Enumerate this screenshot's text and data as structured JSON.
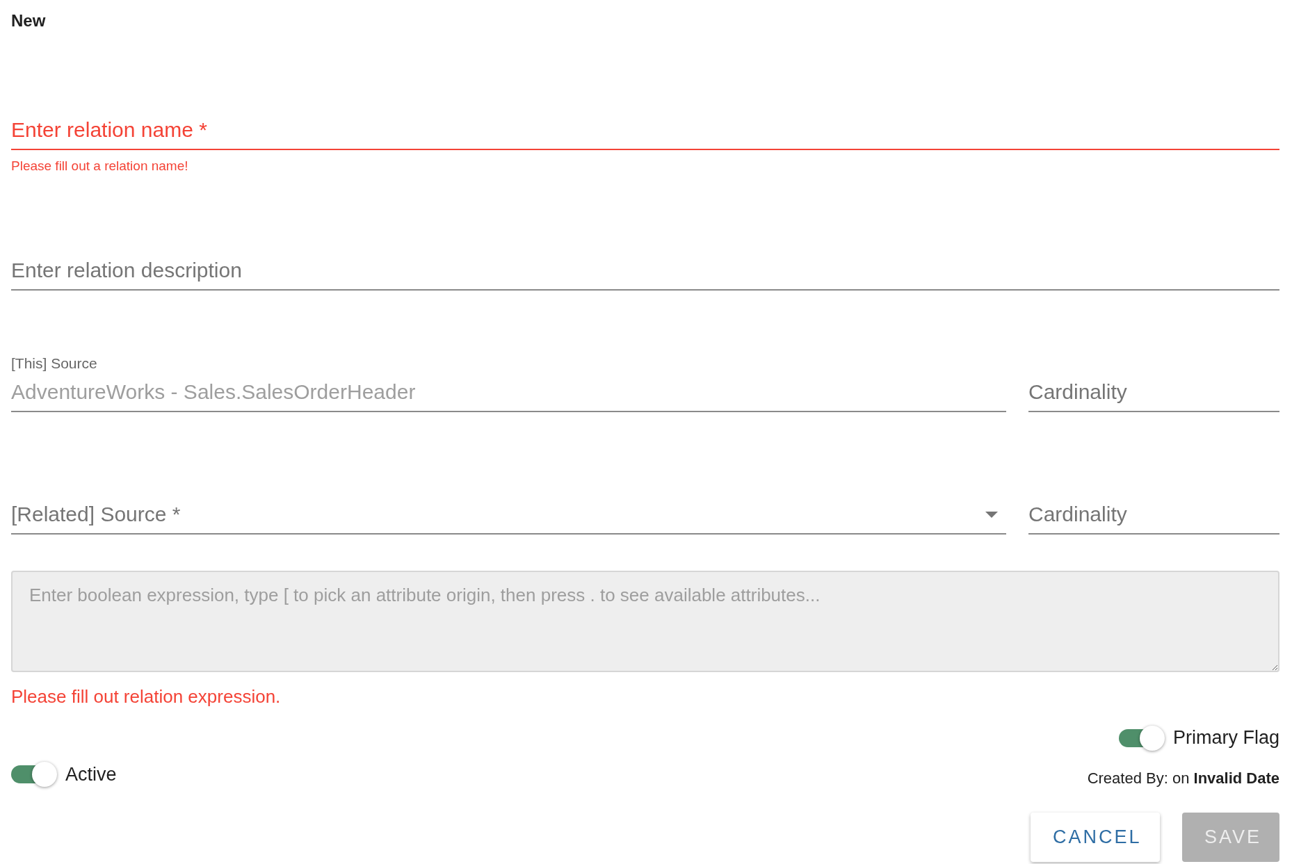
{
  "title": "New",
  "name_field": {
    "placeholder": "Enter relation name *",
    "error": "Please fill out a relation name!",
    "invalid": true
  },
  "description_field": {
    "placeholder": "Enter relation description"
  },
  "this_source": {
    "label": "[This] Source",
    "value": "AdventureWorks - Sales.SalesOrderHeader",
    "disabled": true
  },
  "this_cardinality": {
    "placeholder": "Cardinality"
  },
  "related_source": {
    "placeholder": "[Related] Source *"
  },
  "related_cardinality": {
    "placeholder": "Cardinality"
  },
  "expression": {
    "placeholder": "Enter boolean expression, type [ to pick an attribute origin, then press . to see available attributes...",
    "error": "Please fill out relation expression."
  },
  "primary_flag": {
    "label": "Primary Flag",
    "on": true
  },
  "active": {
    "label": "Active",
    "on": true
  },
  "created_by": "Created By: on **Invalid Date**",
  "buttons": [
    {
      "label": "CANCEL",
      "kind": "outlined"
    },
    {
      "label": "SAVE",
      "kind": "disabled"
    }
  ]
}
